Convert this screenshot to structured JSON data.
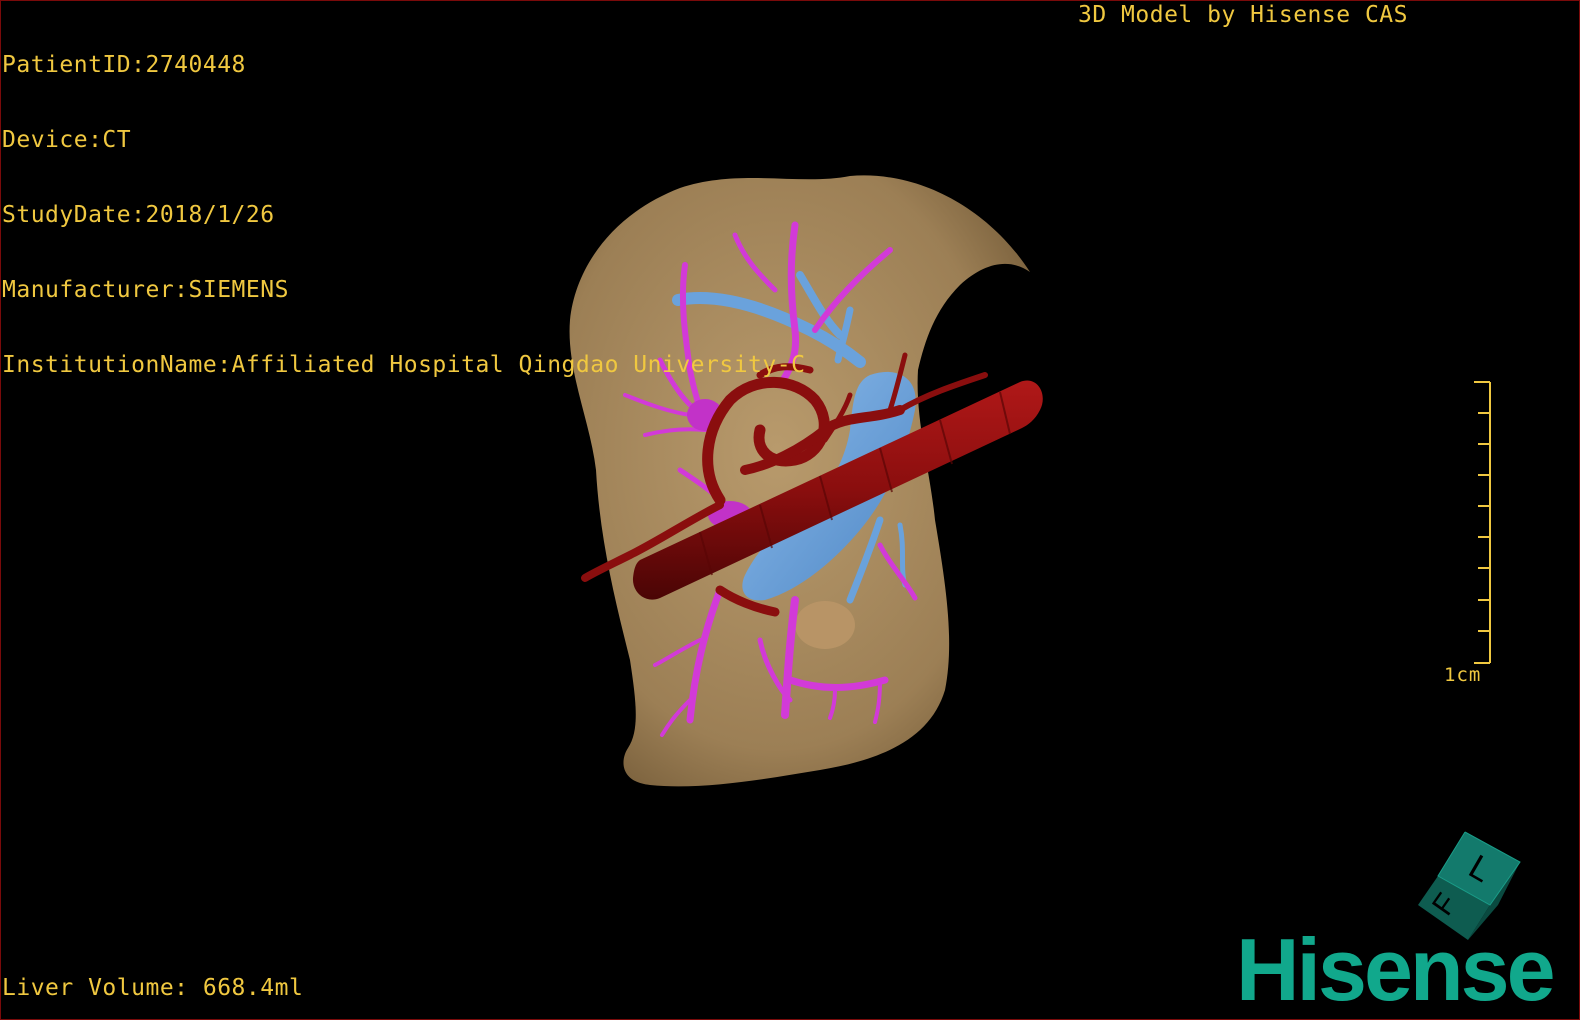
{
  "header": {
    "patient_id": "PatientID:2740448",
    "device": "Device:CT",
    "study_date": "StudyDate:2018/1/26",
    "manufacturer": "Manufacturer:SIEMENS",
    "institution": "InstitutionName:Affiliated Hospital Qingdao University-C"
  },
  "credit": "3D Model by Hisense CAS",
  "footer": {
    "liver_volume": "Liver Volume: 668.4ml"
  },
  "scale_bar": {
    "label": "1cm"
  },
  "orientation_cube": {
    "labels": [
      "F",
      "L"
    ]
  },
  "brand": {
    "name": "Hisense"
  },
  "colors": {
    "overlay_text": "#f0c840",
    "liver": "#a8885c",
    "artery": "#8a0e0e",
    "portal_vein": "#d23ad8",
    "hepatic_vein": "#6aa2dc",
    "brand": "#11a88c"
  }
}
